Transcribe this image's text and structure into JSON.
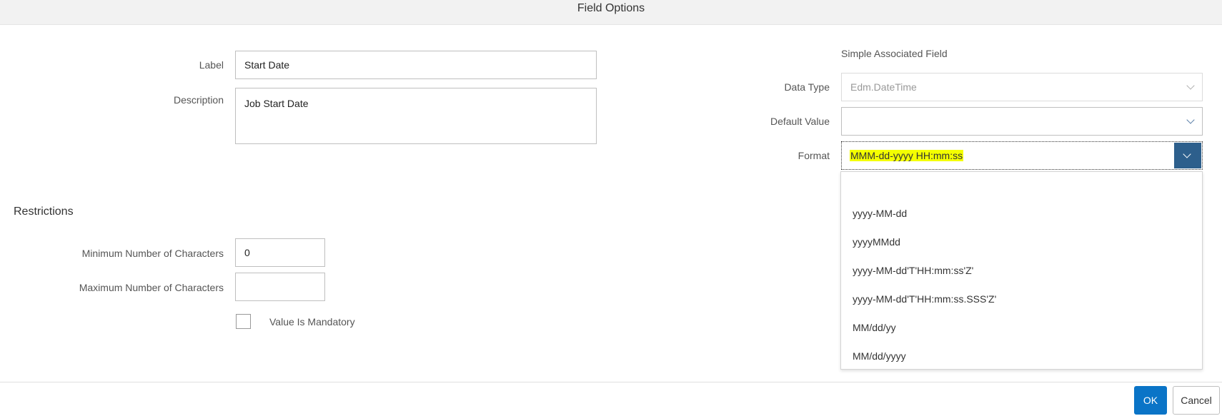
{
  "dialog": {
    "title": "Field Options"
  },
  "left": {
    "label_caption": "Label",
    "label_value": "Start Date",
    "description_caption": "Description",
    "description_value": "Job Start Date"
  },
  "right": {
    "section_label": "Simple Associated Field",
    "data_type_caption": "Data Type",
    "data_type_value": "Edm.DateTime",
    "default_value_caption": "Default Value",
    "default_value": "",
    "format_caption": "Format",
    "format_value": "MMM-dd-yyyy HH:mm:ss",
    "format_options": [
      "",
      "yyyy-MM-dd",
      "yyyyMMdd",
      "yyyy-MM-dd'T'HH:mm:ss'Z'",
      "yyyy-MM-dd'T'HH:mm:ss.SSS'Z'",
      "MM/dd/yy",
      "MM/dd/yyyy"
    ]
  },
  "restrictions": {
    "title": "Restrictions",
    "min_caption": "Minimum Number of Characters",
    "min_value": "0",
    "max_caption": "Maximum Number of Characters",
    "max_value": "",
    "mandatory_label": "Value Is Mandatory",
    "mandatory_checked": false
  },
  "footer": {
    "ok_label": "OK",
    "cancel_label": "Cancel"
  },
  "colors": {
    "primary": "#0a74c7",
    "dropdown_button": "#2d5f8c",
    "highlight": "#f4ff00"
  }
}
